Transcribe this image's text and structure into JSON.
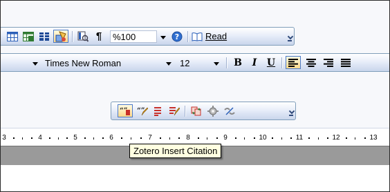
{
  "standard_toolbar": {
    "zoom_value": "%100",
    "read_label": "Read"
  },
  "formatting_toolbar": {
    "font_name": "Times New Roman",
    "font_size": "12",
    "bold_label": "B",
    "italic_label": "I",
    "underline_label": "U",
    "paragraph_mark": "¶"
  },
  "zotero_toolbar": {
    "buttons": [
      "insert-citation",
      "edit-citation",
      "insert-bibliography",
      "edit-bibliography",
      "refresh",
      "document-preferences",
      "unlink-citations"
    ]
  },
  "ruler": {
    "labels": [
      "4",
      "5",
      "6",
      "7",
      "8",
      "9",
      "10",
      "11",
      "12",
      "13"
    ]
  },
  "tooltip": {
    "text": "Zotero Insert Citation"
  },
  "colors": {
    "toolbar_gradient_top": "#ffffff",
    "toolbar_gradient_bottom": "#c9d5ec",
    "active_button": "#ffd98a",
    "tooltip_bg": "#ffffe1",
    "gray_band": "#9a9a9a"
  }
}
